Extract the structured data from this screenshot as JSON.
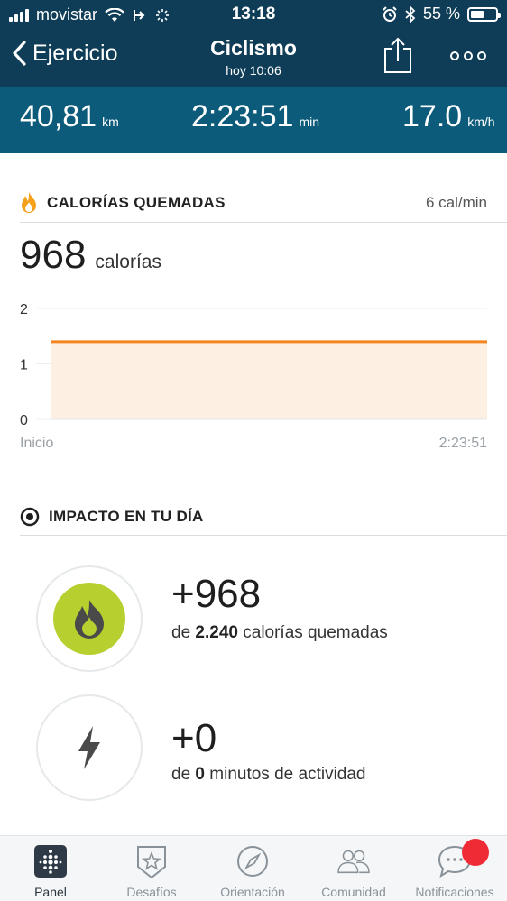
{
  "status": {
    "carrier": "movistar",
    "time": "13:18",
    "battery": "55 %",
    "battery_level": 0.55
  },
  "nav": {
    "back_label": "Ejercicio",
    "title": "Ciclismo",
    "subtitle": "hoy 10:06"
  },
  "stats": {
    "distance": {
      "value": "40,81",
      "unit": "km"
    },
    "duration": {
      "value": "2:23:51",
      "unit": "min"
    },
    "speed": {
      "value": "17.0",
      "unit": "km/h"
    }
  },
  "calories": {
    "title": "CALORÍAS QUEMADAS",
    "rate": "6 cal/min",
    "total": "968",
    "unit": "calorías"
  },
  "chart_data": {
    "type": "area",
    "x": [
      "Inicio",
      "2:23:51"
    ],
    "series": [
      {
        "values": [
          1.4,
          1.4
        ]
      }
    ],
    "yticks": [
      "0",
      "1",
      "2"
    ],
    "ylim": [
      0,
      2
    ],
    "xtick_labels": [
      "Inicio",
      "2:23:51"
    ],
    "line_color": "#f5841f",
    "fill_color": "#fdefe2",
    "grid": true
  },
  "impact": {
    "title": "IMPACTO EN TU DÍA",
    "calories": {
      "value": "+968",
      "prefix": "de",
      "bold": "2.240",
      "rest": "calorías quemadas",
      "icon_bg": "#b7cf2f"
    },
    "minutes": {
      "value": "+0",
      "prefix": "de",
      "bold": "0",
      "rest": "minutos de actividad"
    }
  },
  "tabs": [
    {
      "label": "Panel",
      "icon": "dashboard-icon",
      "active": true
    },
    {
      "label": "Desafíos",
      "icon": "challenges-star-icon",
      "active": false
    },
    {
      "label": "Orientación",
      "icon": "compass-icon",
      "active": false
    },
    {
      "label": "Comunidad",
      "icon": "community-icon",
      "active": false
    },
    {
      "label": "Notificaciones",
      "icon": "chat-bubble-icon",
      "active": false
    }
  ],
  "colors": {
    "header": "#0f3d57",
    "stats_bar": "#0c5b7a",
    "accent_orange": "#f5841f",
    "badge_red": "#ef2b35"
  }
}
